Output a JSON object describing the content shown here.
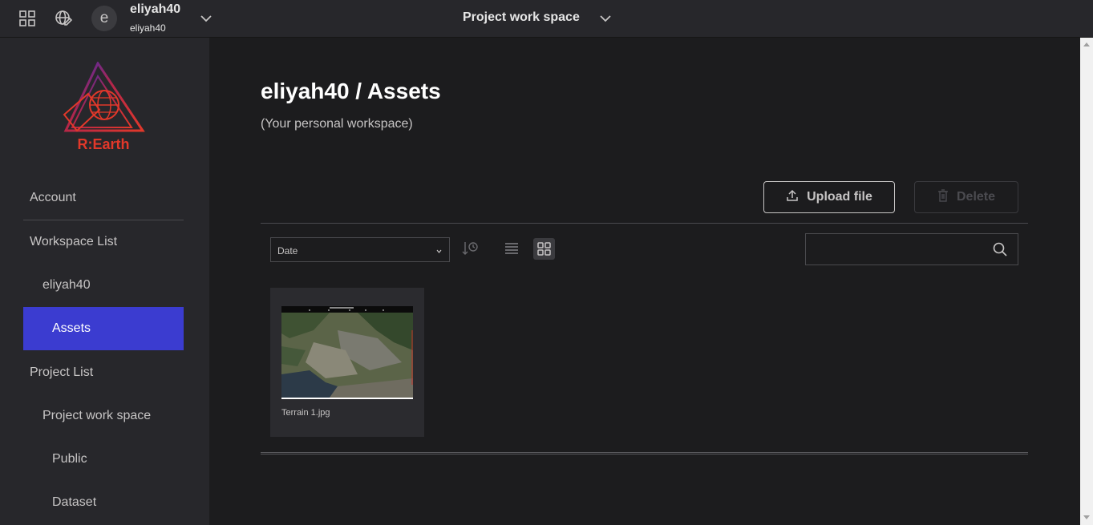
{
  "header": {
    "workspace_name": "eliyah40",
    "workspace_sub": "eliyah40",
    "avatar_letter": "e",
    "project_title": "Project work space"
  },
  "sidebar": {
    "logo_text": "R:Earth",
    "items": [
      {
        "label": "Account"
      },
      {
        "label": "Workspace List"
      },
      {
        "label": "eliyah40"
      },
      {
        "label": "Assets",
        "active": true
      },
      {
        "label": "Project List"
      },
      {
        "label": "Project work space"
      },
      {
        "label": "Public"
      },
      {
        "label": "Dataset"
      }
    ]
  },
  "main": {
    "title": "eliyah40 / Assets",
    "subtitle": "(Your personal workspace)",
    "upload_label": "Upload file",
    "delete_label": "Delete",
    "sort_value": "Date",
    "search_placeholder": "",
    "view_mode": "grid",
    "assets": [
      {
        "name": "Terrain 1.jpg"
      }
    ]
  },
  "colors": {
    "accent": "#3b3cd0",
    "background": "#1c1c1e",
    "panel": "#27272b",
    "brand_red": "#e2382a"
  }
}
